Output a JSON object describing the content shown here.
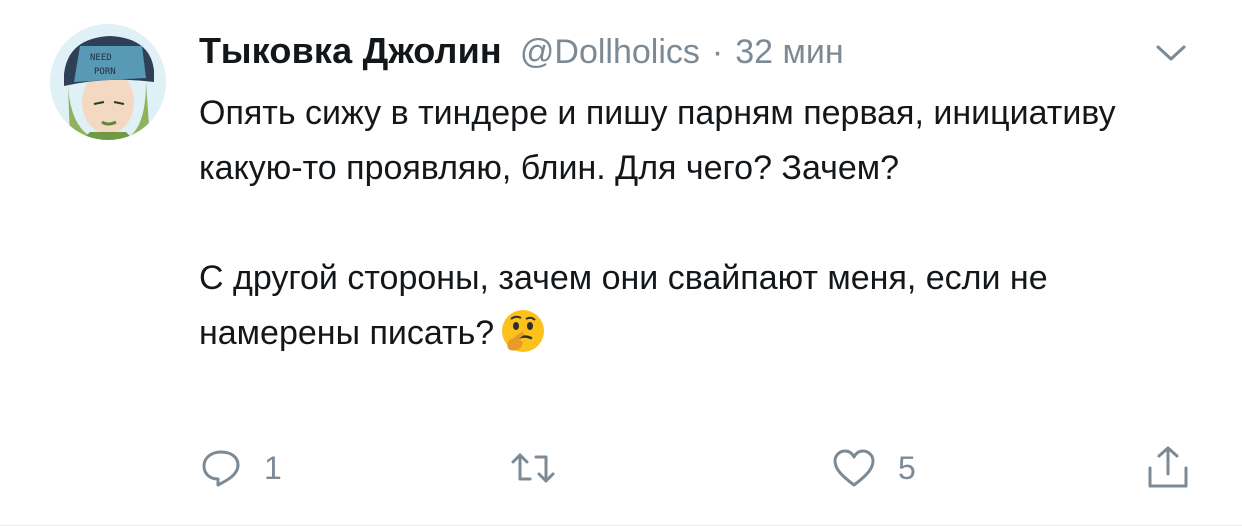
{
  "tweet": {
    "display_name": "Тыковка Джолин",
    "handle": "@Dollholics",
    "separator": "·",
    "time": "32 мин",
    "paragraph1": "Опять сижу в тиндере и пишу парням первая, инициативу какую-то проявляю, блин. Для чего? Зачем?",
    "paragraph2": "С другой стороны, зачем они свайпают меня, если не намерены писать?",
    "emoji": "thinking-face"
  },
  "actions": {
    "reply_icon": "reply-icon",
    "reply_count": "1",
    "retweet_icon": "retweet-icon",
    "retweet_count": "",
    "like_icon": "heart-icon",
    "like_count": "5",
    "share_icon": "share-icon"
  },
  "colors": {
    "text": "#14171a",
    "secondary": "#7c8a96",
    "avatar_bg": "#e6f2f8"
  }
}
